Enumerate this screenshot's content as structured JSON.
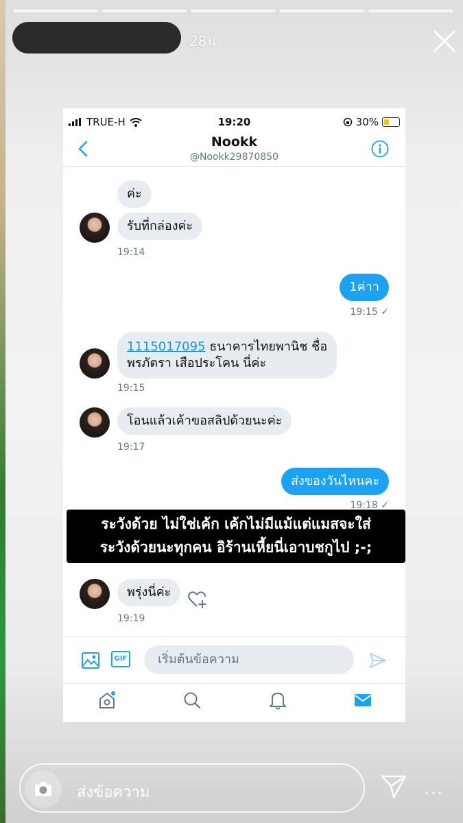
{
  "story": {
    "time": "28น",
    "reply_placeholder": "ส่งข้อความ",
    "more_label": "···",
    "caption_lines": [
      "ระวังด้วย ไม่ใช่เค้ก เค้กไม่มีแม้แต่แมสจะใส่",
      "ระวังด้วยนะทุกคน อิร้านเหี้ยนี่เอาบชกูไป ;-;"
    ]
  },
  "phone": {
    "status": {
      "carrier": "TRUE-H",
      "time": "19:20",
      "battery": "30%"
    },
    "header": {
      "name": "Nookk",
      "handle": "@Nookk29870850"
    },
    "messages": {
      "m1": "ค่ะ",
      "m2": "รับที่กล่องค่ะ",
      "t1": "19:14",
      "m3": "1ค่าา",
      "t2": "19:15 ✓",
      "m4_account": "1115017095",
      "m4_rest": " ธนาคารไทยพานิช ชื่อ",
      "m4_line2": "พรภัตรา เสือประโคน นี่ค่ะ",
      "t3": "19:15",
      "m5": "โอนแล้วเค้าขอสลิปด้วยนะค่ะ",
      "t4": "19:17",
      "m6": "ส่งของวันไหนคะ",
      "t5": "19:18 ✓",
      "m7": "พรุ่งนี่ค่ะ",
      "t6": "19:19"
    },
    "composer": {
      "gif_label": "GIF",
      "placeholder": "เริ่มต้นข้อความ"
    }
  },
  "colors": {
    "accent": "#1da1f2",
    "bubble_in": "#e6ecf0",
    "caption_bg": "#000000"
  }
}
